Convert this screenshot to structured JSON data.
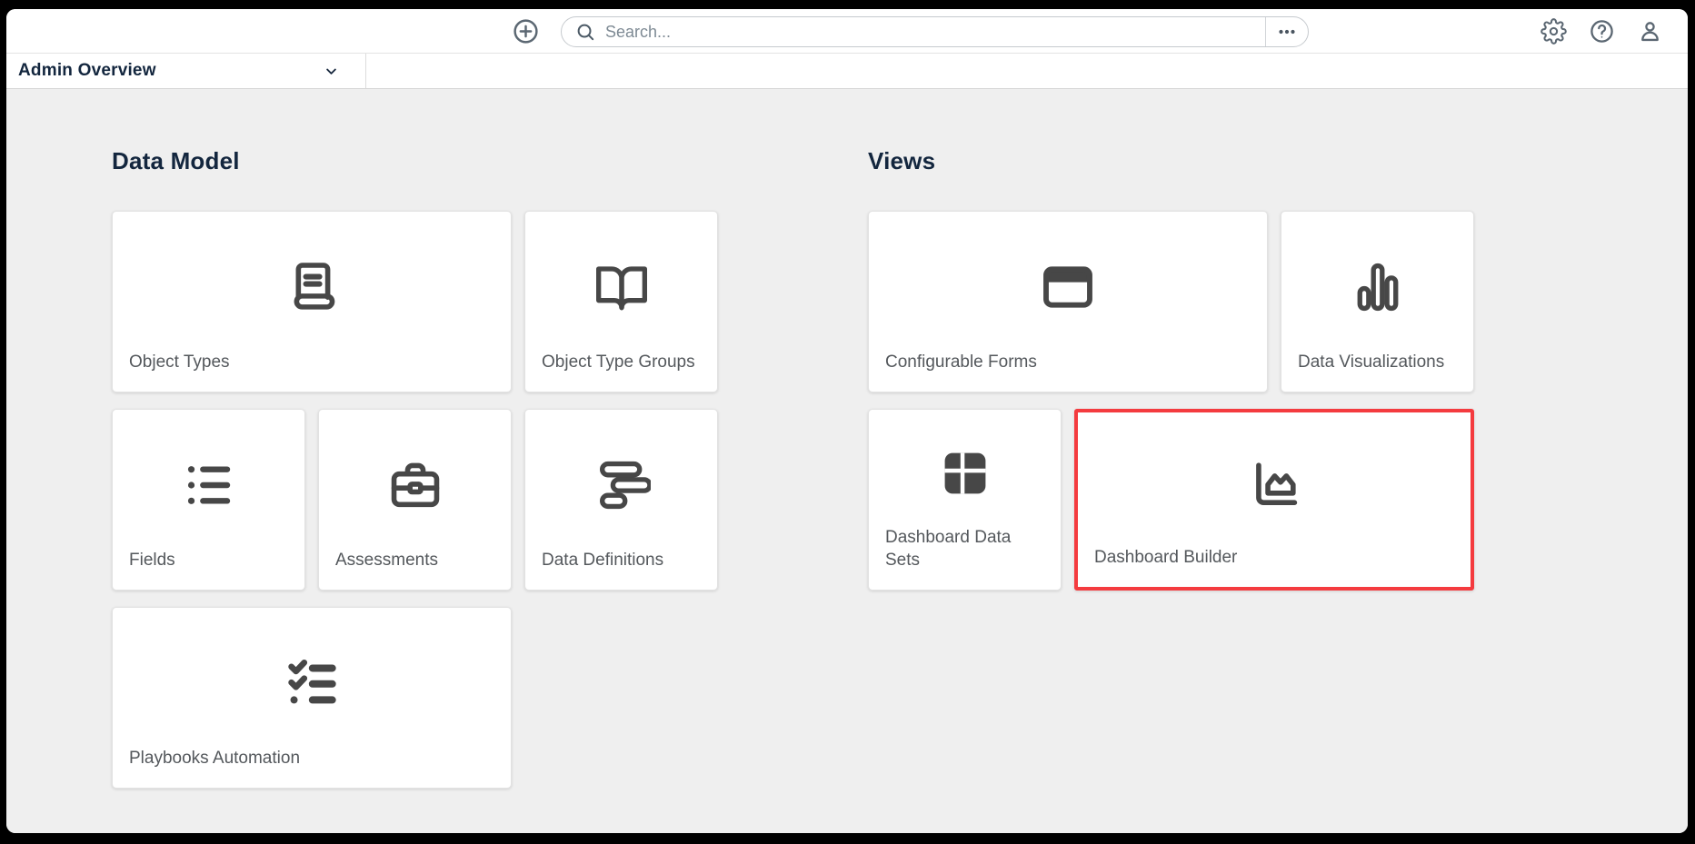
{
  "topbar": {
    "create_button": {
      "icon": "plus-circle"
    },
    "search": {
      "placeholder": "Search...",
      "icon": "magnifier",
      "more_icon": "ellipsis"
    },
    "actions": [
      {
        "name": "settings",
        "icon": "gear"
      },
      {
        "name": "help",
        "icon": "help"
      },
      {
        "name": "account",
        "icon": "user"
      }
    ]
  },
  "navbar": {
    "dropdown": {
      "label": "Admin Overview",
      "icon": "chevron-down"
    }
  },
  "sections": [
    {
      "title": "Data Model",
      "cards": [
        {
          "label": "Object Types",
          "icon": "book",
          "wide": true,
          "highlighted": false
        },
        {
          "label": "Object Type Groups",
          "icon": "book-open",
          "wide": false,
          "highlighted": false
        },
        {
          "label": "Fields",
          "icon": "list",
          "wide": false,
          "highlighted": false
        },
        {
          "label": "Assessments",
          "icon": "briefcase",
          "wide": false,
          "highlighted": false
        },
        {
          "label": "Data Definitions",
          "icon": "data-bars",
          "wide": false,
          "highlighted": false
        },
        {
          "label": "Playbooks Automation",
          "icon": "checklist",
          "wide": true,
          "highlighted": false
        }
      ]
    },
    {
      "title": "Views",
      "cards": [
        {
          "label": "Configurable Forms",
          "icon": "window",
          "wide": true,
          "highlighted": false
        },
        {
          "label": "Data Visualizations",
          "icon": "bar-chart",
          "wide": false,
          "highlighted": false
        },
        {
          "label": "Dashboard Data Sets",
          "icon": "table-grid",
          "wide": false,
          "highlighted": false
        },
        {
          "label": "Dashboard Builder",
          "icon": "area-chart",
          "wide": true,
          "highlighted": true
        }
      ]
    }
  ],
  "colors": {
    "highlight": "#f43b3f",
    "heading": "#13263e",
    "icon": "#474747",
    "label": "#54585c",
    "topbar_icon": "#5b6772",
    "body_bg": "#efefef"
  }
}
